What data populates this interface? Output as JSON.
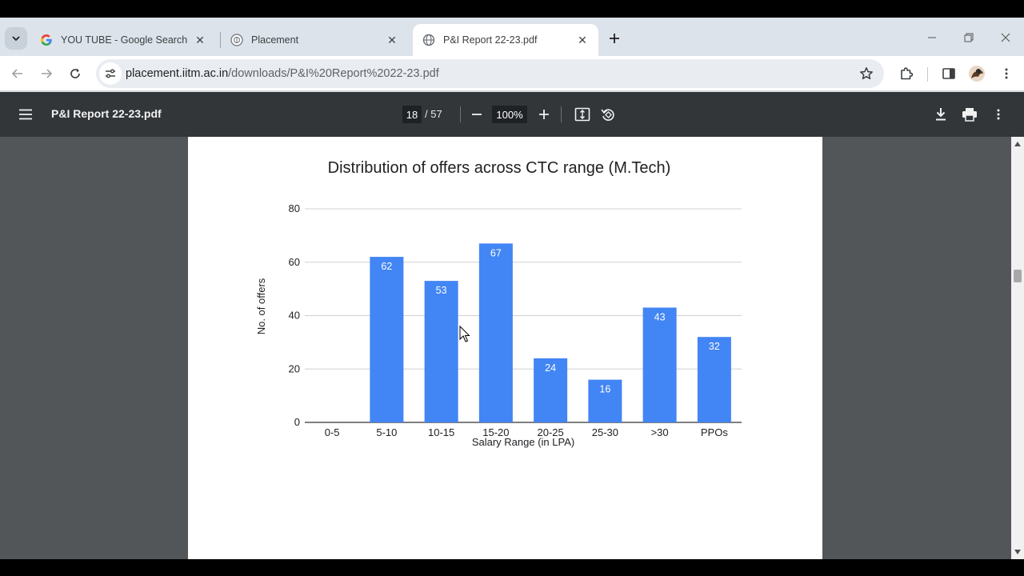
{
  "browser": {
    "tabs": [
      {
        "title": "YOU TUBE - Google Search",
        "favicon": "google-icon"
      },
      {
        "title": "Placement",
        "favicon": "iitm-logo-icon"
      },
      {
        "title": "P&I Report 22-23.pdf",
        "favicon": "globe-icon"
      }
    ],
    "active_tab": 2,
    "url_host": "placement.iitm.ac.in",
    "url_path": "/downloads/P&I%20Report%2022-23.pdf"
  },
  "pdf_viewer": {
    "title": "P&I Report 22-23.pdf",
    "current_page": "18",
    "total_pages": "/ 57",
    "zoom": "100%"
  },
  "chart_data": {
    "type": "bar",
    "title": "Distribution of offers across CTC range (M.Tech)",
    "xlabel": "Salary Range (in LPA)",
    "ylabel": "No. of offers",
    "categories": [
      "0-5",
      "5-10",
      "10-15",
      "15-20",
      "20-25",
      "25-30",
      ">30",
      "PPOs"
    ],
    "values": [
      0,
      62,
      53,
      67,
      24,
      16,
      43,
      32
    ],
    "data_labels": [
      "",
      "62",
      "53",
      "67",
      "24",
      "16",
      "43",
      "32"
    ],
    "ylim": [
      0,
      80
    ],
    "yticks": [
      "0",
      "20",
      "40",
      "60",
      "80"
    ],
    "grid": true,
    "bar_color": "#4285f4",
    "label_color": "#ffffff"
  }
}
